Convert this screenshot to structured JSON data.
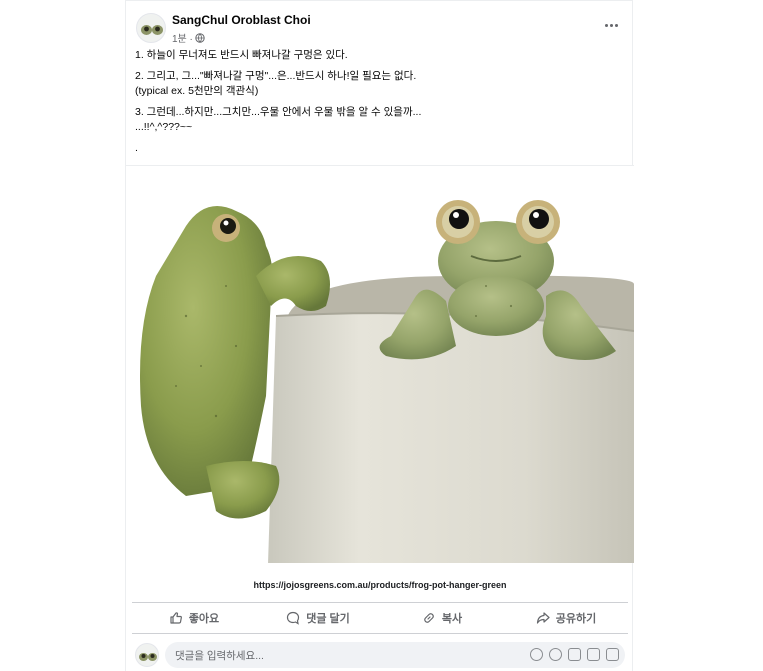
{
  "post": {
    "author": "SangChul Oroblast Choi",
    "time": "1분 ·",
    "lines": [
      "1. 하늘이 무너져도 반드시 빠져나갈 구멍은 있다.",
      "2. 그리고, 그...\"빠져나갈 구멍\"...은...반드시 하나!일 필요는 없다.",
      "(typical ex. 5천만의 객관식)",
      "3. 그런데...하지만...그치만...우물 안에서 우물 밖을 알 수 있을까...",
      "...!!^,^???~~",
      "."
    ],
    "image_caption": "https://jojosgreens.com.au/products/frog-pot-hanger-green"
  },
  "actions": {
    "like": "좋아요",
    "comment": "댓글 달기",
    "copy": "복사",
    "share": "공유하기"
  },
  "comment_box": {
    "placeholder": "댓글을 입력하세요..."
  },
  "icons": [
    "globe-icon",
    "more-icon",
    "like-icon",
    "comment-icon",
    "copy-icon",
    "share-icon",
    "emoji-icon",
    "camera-icon",
    "gif-icon",
    "sticker-icon"
  ],
  "colors": {
    "text": "#050505",
    "secondary": "#65676b",
    "divider": "#ced0d4",
    "input_bg": "#f0f2f5"
  }
}
